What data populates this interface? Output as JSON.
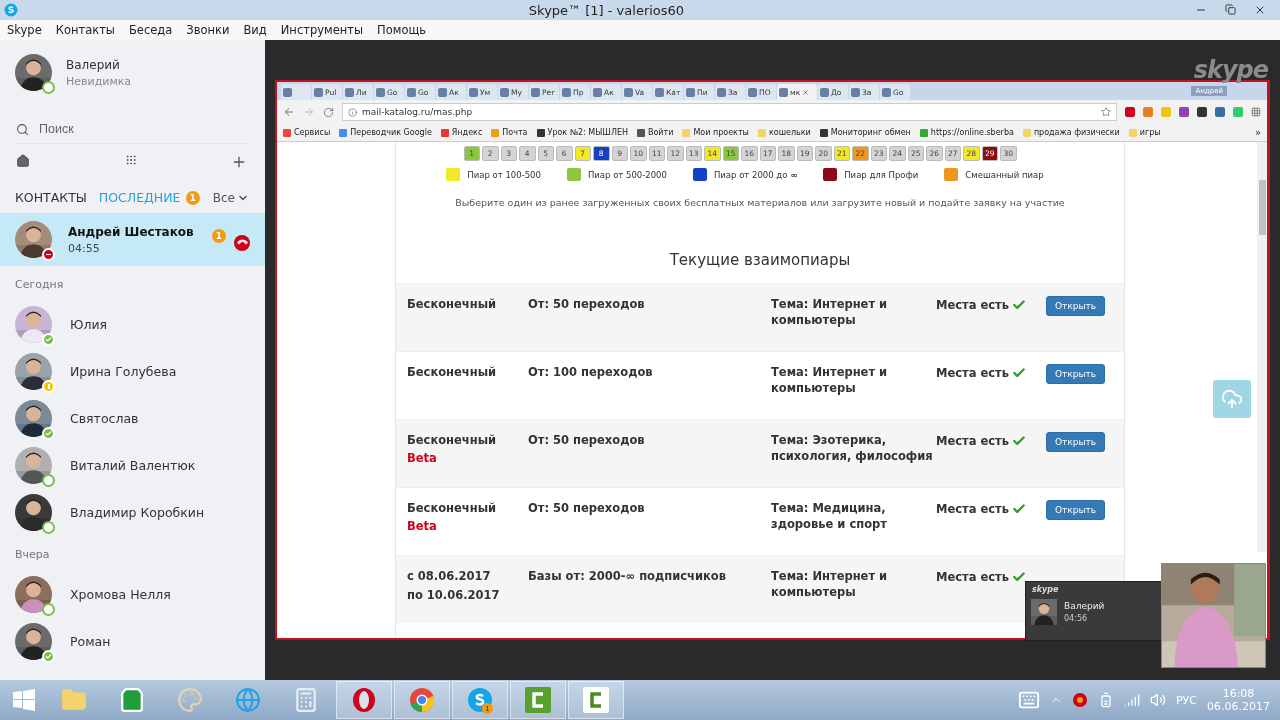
{
  "window": {
    "title": "Skype™ [1] - valerios60"
  },
  "menu": [
    "Skype",
    "Контакты",
    "Беседа",
    "Звонки",
    "Вид",
    "Инструменты",
    "Помощь"
  ],
  "profile": {
    "name": "Валерий",
    "status": "Невидимка"
  },
  "search": {
    "placeholder": "Поиск"
  },
  "list_tabs": [
    {
      "label": "КОНТАКТЫ",
      "selected": false
    },
    {
      "label": "ПОСЛЕДНИЕ",
      "selected": true,
      "badge": "1"
    }
  ],
  "filter": "Все",
  "active_chat": {
    "name": "Андрей Шестаков",
    "time": "04:55",
    "badge": "1",
    "kind": "busy",
    "selected": true
  },
  "groups": [
    {
      "title": "Сегодня",
      "contacts": [
        {
          "name": "Юлия",
          "kind": "online"
        },
        {
          "name": "Ирина Голубева",
          "kind": "away"
        },
        {
          "name": "Святослав",
          "kind": "online"
        },
        {
          "name": "Виталий Валентюк",
          "kind": "offline"
        },
        {
          "name": "Владимир Коробкин",
          "kind": "offline"
        }
      ]
    },
    {
      "title": "Вчера",
      "contacts": [
        {
          "name": "Хромова Нелля",
          "kind": "offline"
        },
        {
          "name": "Роман",
          "kind": "online"
        }
      ]
    }
  ],
  "skype_logo": "skype",
  "shared_screen": {
    "tabs": [
      {
        "selected": false
      },
      {
        "label": "Pul",
        "selected": false
      },
      {
        "label": "Ли",
        "selected": false
      },
      {
        "label": "Go",
        "selected": false
      },
      {
        "label": "Go",
        "selected": false
      },
      {
        "label": "Ак",
        "selected": false
      },
      {
        "label": "Ум",
        "selected": false
      },
      {
        "label": "My",
        "selected": false
      },
      {
        "label": "Рег",
        "selected": false
      },
      {
        "label": "Пр",
        "selected": false
      },
      {
        "label": "Ак",
        "selected": false
      },
      {
        "label": "Va",
        "selected": false
      },
      {
        "label": "Кат",
        "selected": false
      },
      {
        "label": "Пи",
        "selected": false
      },
      {
        "label": "За",
        "selected": false
      },
      {
        "label": "ПО",
        "selected": false
      },
      {
        "label": "мк",
        "selected": true
      },
      {
        "label": "До",
        "selected": false
      },
      {
        "label": "За",
        "selected": false
      },
      {
        "label": "Go",
        "selected": false
      }
    ],
    "user": "Андрей",
    "url": "mail-katalog.ru/mas.php",
    "bookmarks": [
      "Сервисы",
      "Переводчик Google",
      "Яндекс",
      "Почта",
      "Урок №2: МЫШЛЕН",
      "Войти",
      "Мои проекты",
      "кошельки",
      "Мониторинг обмен",
      "https://online.sberba",
      "продажа физически",
      "игры"
    ],
    "bookmarks_more": "»",
    "days": [
      {
        "label": "1",
        "color": "#8dc63f"
      },
      {
        "label": "2",
        "color": "#d4d4d4"
      },
      {
        "label": "3",
        "color": "#d4d4d4"
      },
      {
        "label": "4",
        "color": "#d4d4d4"
      },
      {
        "label": "5",
        "color": "#d4d4d4"
      },
      {
        "label": "6",
        "color": "#d4d4d4"
      },
      {
        "label": "7",
        "color": "#f2e82a"
      },
      {
        "label": "8",
        "color": "#1540c8"
      },
      {
        "label": "9",
        "color": "#d4d4d4"
      },
      {
        "label": "10",
        "color": "#d4d4d4"
      },
      {
        "label": "11",
        "color": "#d4d4d4"
      },
      {
        "label": "12",
        "color": "#d4d4d4"
      },
      {
        "label": "13",
        "color": "#d4d4d4"
      },
      {
        "label": "14",
        "color": "#f2e82a"
      },
      {
        "label": "15",
        "color": "#8dc63f"
      },
      {
        "label": "16",
        "color": "#d4d4d4"
      },
      {
        "label": "17",
        "color": "#d4d4d4"
      },
      {
        "label": "18",
        "color": "#d4d4d4"
      },
      {
        "label": "19",
        "color": "#d4d4d4"
      },
      {
        "label": "20",
        "color": "#d4d4d4"
      },
      {
        "label": "21",
        "color": "#f2e82a"
      },
      {
        "label": "22",
        "color": "#f0961e"
      },
      {
        "label": "23",
        "color": "#d4d4d4"
      },
      {
        "label": "24",
        "color": "#d4d4d4"
      },
      {
        "label": "25",
        "color": "#d4d4d4"
      },
      {
        "label": "26",
        "color": "#d4d4d4"
      },
      {
        "label": "27",
        "color": "#d4d4d4"
      },
      {
        "label": "28",
        "color": "#f2e82a"
      },
      {
        "label": "29",
        "color": "#8b0a14"
      },
      {
        "label": "30",
        "color": "#d4d4d4"
      }
    ],
    "legend": [
      {
        "label": "Пиар от 100-500",
        "color": "#f2e82a"
      },
      {
        "label": "Пиар от 500-2000",
        "color": "#8dc63f"
      },
      {
        "label": "Пиар от 2000 до **∞**",
        "color": "#1540c8"
      },
      {
        "label": "Пиар для Профи",
        "color": "#8b0a14"
      },
      {
        "label": "Смешанный пиар",
        "color": "#f0961e"
      }
    ],
    "hint": "Выберите один из ранее загруженных своих бесплатных материалов или загрузите новый и подайте заявку на участие",
    "heading": "Текущие взаимопиары",
    "rows": [
      {
        "period": [
          "Бесконечный"
        ],
        "traffic": "От: 50 переходов",
        "topic": "Тема: Интернет и компьютеры",
        "places": "Места есть",
        "button": "Открыть"
      },
      {
        "period": [
          "Бесконечный"
        ],
        "traffic": "От: 100 переходов",
        "topic": "Тема: Интернет и компьютеры",
        "places": "Места есть",
        "button": "Открыть"
      },
      {
        "period": [
          "Бесконечный"
        ],
        "beta_label": "Beta",
        "traffic": "От: 50 переходов",
        "topic": "Тема: Эзотерика, психология, философия",
        "places": "Места есть",
        "button": "Открыть"
      },
      {
        "period": [
          "Бесконечный"
        ],
        "beta_label": "Beta",
        "traffic": "От: 50 переходов",
        "topic": "Тема: Медицина, здоровье и спорт",
        "places": "Места есть",
        "button": "Открыть"
      },
      {
        "period": [
          "с  08.06.2017",
          "по 10.06.2017"
        ],
        "traffic": "Базы от: 2000-∞ подписчиков",
        "topic": "Тема: Интернет и компьютеры",
        "places": "Места есть"
      }
    ]
  },
  "call_popup": {
    "logo": "skype",
    "name": "Валерий",
    "time": "04:56"
  },
  "taskbar": {
    "apps": [
      {
        "kind": "explorer",
        "running": false
      },
      {
        "kind": "store",
        "running": false
      },
      {
        "kind": "paint",
        "running": false
      },
      {
        "kind": "ie",
        "running": false
      },
      {
        "kind": "calculator",
        "running": false
      },
      {
        "kind": "opera",
        "running": true
      },
      {
        "kind": "chrome",
        "running": true
      },
      {
        "kind": "skype",
        "running": true,
        "badge": "1"
      },
      {
        "kind": "camtasia",
        "running": true
      },
      {
        "kind": "camtasia-light",
        "running": true
      }
    ],
    "language": "РУС",
    "time": "16:08",
    "date": "06.06.2017"
  }
}
